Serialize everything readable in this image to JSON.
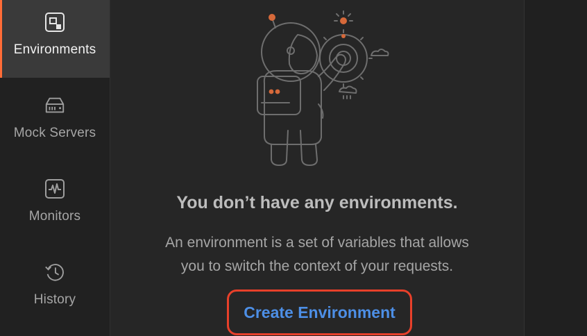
{
  "sidebar": {
    "items": [
      {
        "label": "Environments",
        "icon": "environments-icon",
        "active": true
      },
      {
        "label": "Mock Servers",
        "icon": "server-icon",
        "active": false
      },
      {
        "label": "Monitors",
        "icon": "monitor-pulse-icon",
        "active": false
      },
      {
        "label": "History",
        "icon": "history-clock-icon",
        "active": false
      }
    ]
  },
  "empty_state": {
    "illustration": "astronaut-with-dial-icon",
    "title": "You don’t have any environments.",
    "description_line1": "An environment is a set of variables that allows",
    "description_line2": "you to switch the context of your requests.",
    "cta_label": "Create Environment"
  },
  "colors": {
    "accent_active": "#ff6c37",
    "link_blue": "#4d8fe6",
    "highlight_ring": "#e8402a"
  }
}
